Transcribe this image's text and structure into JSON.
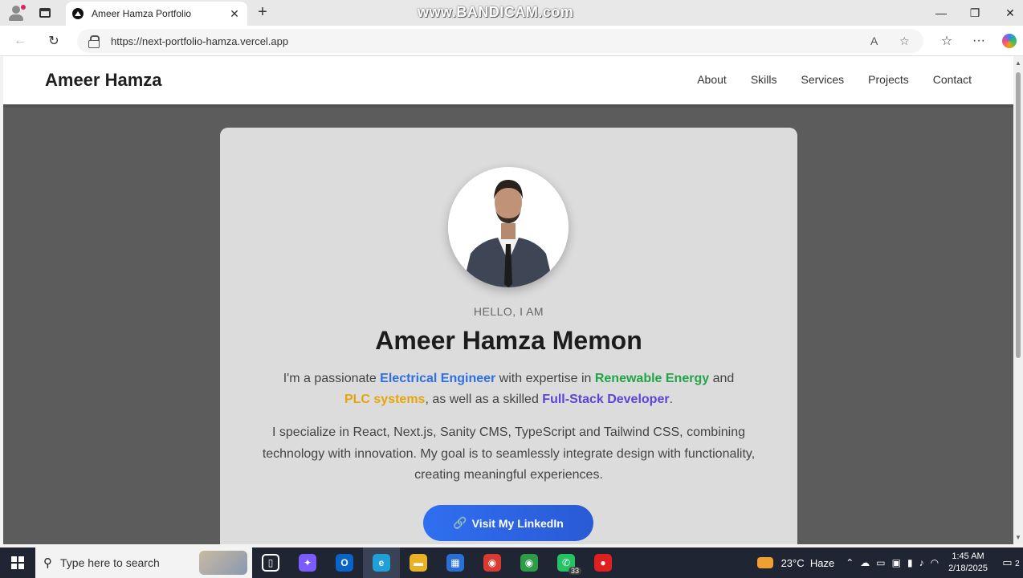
{
  "browser": {
    "tab_title": "Ameer Hamza Portfolio",
    "tab_close": "✕",
    "new_tab": "+",
    "watermark": "www.BANDICAM.com",
    "url": "https://next-portfolio-hamza.vercel.app",
    "controls": {
      "minimize": "—",
      "restore": "❐",
      "close": "✕"
    },
    "nav": {
      "back": "←",
      "reload": "↻"
    },
    "url_icons": {
      "read_aloud": "A",
      "favorite": "☆"
    },
    "toolbar": {
      "favorites": "☆",
      "more": "···"
    }
  },
  "site": {
    "brand": "Ameer Hamza",
    "nav": [
      "About",
      "Skills",
      "Services",
      "Projects",
      "Contact"
    ],
    "hero": {
      "greeting": "HELLO, I AM",
      "name": "Ameer Hamza Memon",
      "intro": {
        "p1": "I'm a passionate ",
        "h1": "Electrical Engineer",
        "p2": " with expertise in ",
        "h2": "Renewable Energy",
        "p3": " and ",
        "h3": "PLC systems",
        "p4": ", as well as a skilled ",
        "h4": "Full-Stack Developer",
        "p5": "."
      },
      "description": "I specialize in React, Next.js, Sanity CMS, TypeScript and Tailwind CSS, combining technology with innovation. My goal is to seamlessly integrate design with functionality, creating meaningful experiences.",
      "cta_icon": "🔗",
      "cta_label": "Visit My LinkedIn"
    },
    "colors": {
      "electrical": "#2f6fe0",
      "renewable": "#22a447",
      "plc": "#e5a50a",
      "fullstack": "#5a45d8",
      "cta": "#2f6ff0"
    }
  },
  "taskbar": {
    "search_placeholder": "Type here to search",
    "apps": [
      {
        "name": "task-view",
        "glyph": "▯",
        "color": "#1f2533"
      },
      {
        "name": "copilot",
        "glyph": "✦",
        "color": "#7b5cff"
      },
      {
        "name": "outlook",
        "glyph": "O",
        "color": "#0a64c8"
      },
      {
        "name": "edge",
        "glyph": "e",
        "color": "#1fa0d8"
      },
      {
        "name": "file-explorer",
        "glyph": "▬",
        "color": "#e8b224"
      },
      {
        "name": "store",
        "glyph": "▦",
        "color": "#2a6fd6"
      },
      {
        "name": "chrome",
        "glyph": "◉",
        "color": "#d93b30"
      },
      {
        "name": "chrome-profile",
        "glyph": "◉",
        "color": "#2e9c47"
      },
      {
        "name": "whatsapp",
        "glyph": "✆",
        "color": "#25c264"
      },
      {
        "name": "bandicam",
        "glyph": "●",
        "color": "#e02020"
      }
    ],
    "whatsapp_badge": "33",
    "weather_temp": "23°C",
    "weather_desc": "Haze",
    "time": "1:45 AM",
    "date": "2/18/2025",
    "notifications": "2"
  }
}
